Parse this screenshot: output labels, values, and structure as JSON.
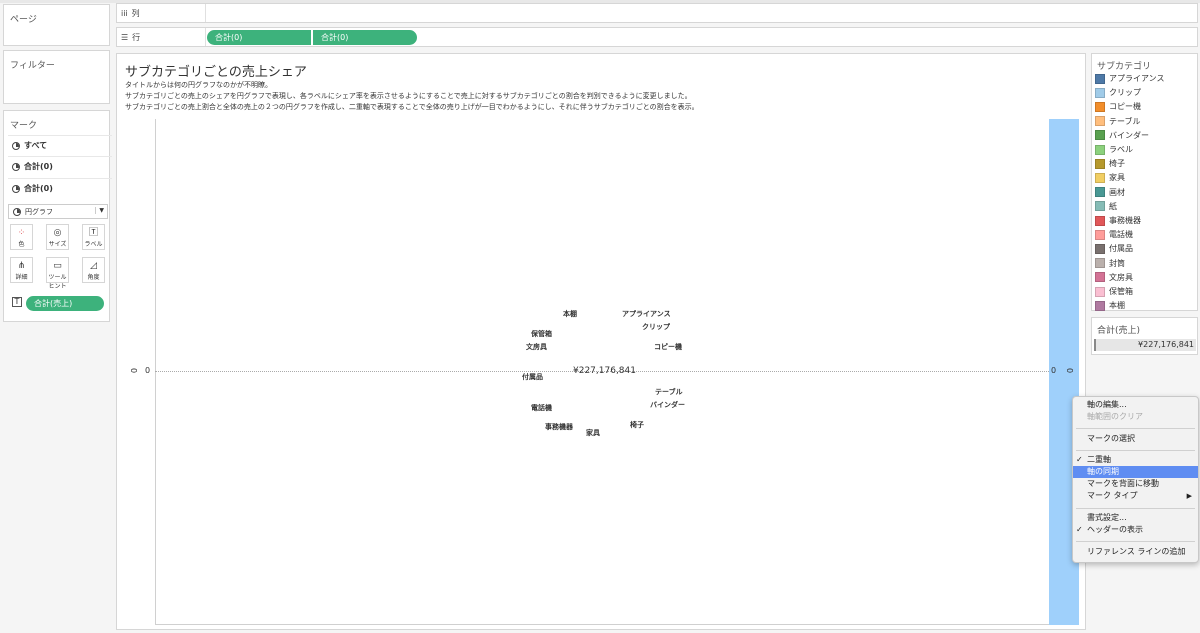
{
  "left": {
    "pages_title": "ページ",
    "filters_title": "フィルター",
    "marks_title": "マーク",
    "mark_rows": [
      {
        "label": "すべて"
      },
      {
        "label": "合計(0)"
      },
      {
        "label": "合計(0)"
      }
    ],
    "mark_type": "円グラフ",
    "mark_buttons": [
      {
        "label": "色",
        "icon": "color-dots-icon"
      },
      {
        "label": "サイズ",
        "icon": "size-icon"
      },
      {
        "label": "ラベル",
        "icon": "text-label-icon"
      },
      {
        "label": "詳細",
        "icon": "detail-icon"
      },
      {
        "label": "ツールヒント",
        "icon": "tooltip-icon"
      },
      {
        "label": "角度",
        "icon": "angle-icon"
      }
    ],
    "mark_pill": "合計(売上)"
  },
  "shelves": {
    "columns_label": "列",
    "rows_label": "行",
    "row_pills": [
      "合計(0)",
      "合計(0)"
    ]
  },
  "sheet": {
    "title": "サブカテゴリごとの売上シェア",
    "desc": [
      "タイトルからは何の円グラフなのかが不明瞭。",
      "サブカテゴリごとの売上のシェアを円グラフで表現し、各ラベルにシェア率を表示させるようにすることで売上に対するサブカテゴリごとの割合を判別できるように変更しました。",
      "サブカテゴリごとの売上割合と全体の売上の２つの円グラフを作成し、二重軸で表現することで全体の売り上げが一目でわかるようにし、それに伴うサブカテゴリごとの割合を表示。"
    ],
    "left_axis_header": "0",
    "left_axis_tick": "0",
    "right_axis_tick": "0",
    "right_axis_header": "0",
    "center_value": "¥227,176,841",
    "slice_labels": [
      "本棚",
      "アプライアンス",
      "クリップ",
      "保管箱",
      "文房具",
      "コピー機",
      "付属品",
      "テーブル",
      "バインダー",
      "電話機",
      "事務機器",
      "椅子",
      "家具"
    ]
  },
  "legend": {
    "title": "サブカテゴリ",
    "items": [
      {
        "label": "アプライアンス",
        "color": "#4e79a7"
      },
      {
        "label": "クリップ",
        "color": "#a0cbe8"
      },
      {
        "label": "コピー機",
        "color": "#f28e2b"
      },
      {
        "label": "テーブル",
        "color": "#ffbe7d"
      },
      {
        "label": "バインダー",
        "color": "#59a14f"
      },
      {
        "label": "ラベル",
        "color": "#8cd17d"
      },
      {
        "label": "椅子",
        "color": "#b6992d"
      },
      {
        "label": "家具",
        "color": "#f1ce63"
      },
      {
        "label": "画材",
        "color": "#499894"
      },
      {
        "label": "紙",
        "color": "#86bcb6"
      },
      {
        "label": "事務機器",
        "color": "#e15759"
      },
      {
        "label": "電話機",
        "color": "#ff9d9a"
      },
      {
        "label": "付属品",
        "color": "#79706e"
      },
      {
        "label": "封筒",
        "color": "#bab0ac"
      },
      {
        "label": "文房具",
        "color": "#d37295"
      },
      {
        "label": "保管箱",
        "color": "#fabfd2"
      },
      {
        "label": "本棚",
        "color": "#b07aa1"
      }
    ]
  },
  "size_legend": {
    "title": "合計(売上)",
    "value": "¥227,176,841"
  },
  "context_menu": {
    "items": [
      {
        "label": "軸の編集...",
        "disabled": false
      },
      {
        "label": "軸範囲のクリア",
        "disabled": true
      },
      {
        "label": "マークの選択",
        "disabled": false
      },
      {
        "label": "二重軸",
        "checked": true
      },
      {
        "label": "軸の同期",
        "highlighted": true
      },
      {
        "label": "マークを背面に移動"
      },
      {
        "label": "マーク タイプ",
        "submenu": true
      },
      {
        "label": "書式設定..."
      },
      {
        "label": "ヘッダーの表示",
        "checked": true
      },
      {
        "label": "リファレンス ラインの追加"
      }
    ]
  },
  "colors": {
    "pill": "#3db27c",
    "axis_highlight": "#9fd0fb",
    "menu_highlight": "#5f8df2"
  }
}
